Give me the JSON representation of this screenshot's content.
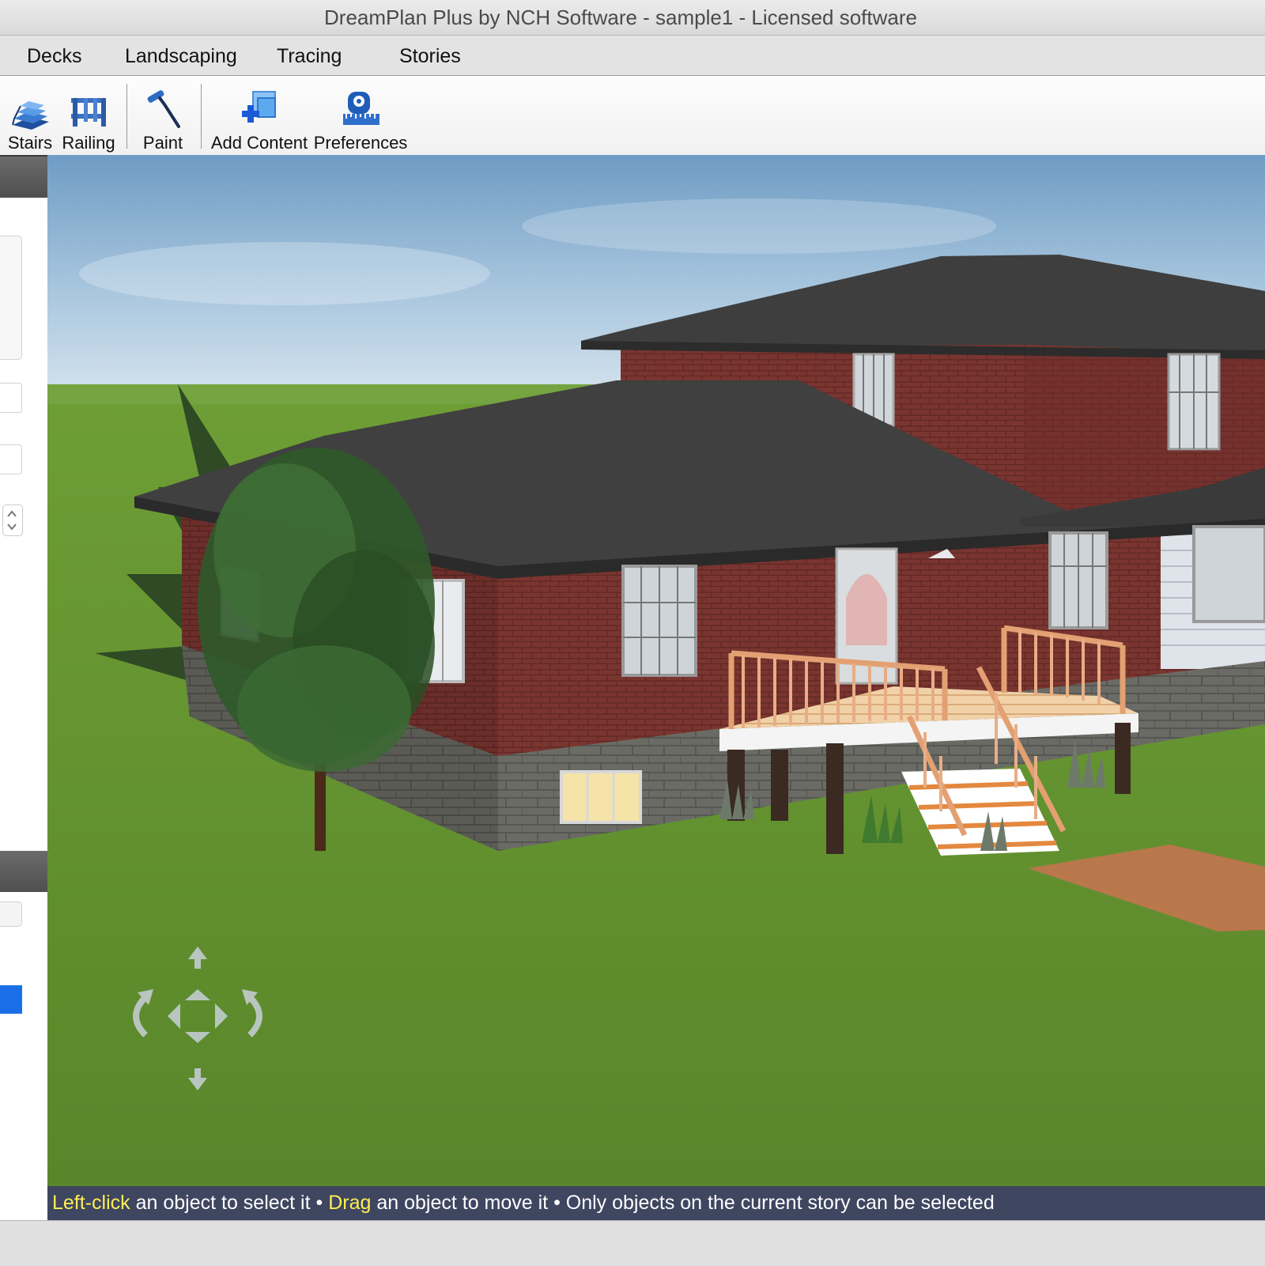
{
  "window": {
    "title": "DreamPlan Plus by NCH Software - sample1 - Licensed software"
  },
  "menu": {
    "items": [
      {
        "label": "Decks"
      },
      {
        "label": "Landscaping"
      },
      {
        "label": "Tracing"
      },
      {
        "label": "Stories"
      }
    ]
  },
  "toolbar": {
    "stairs": {
      "label": "Stairs",
      "icon": "stairs-icon"
    },
    "railing": {
      "label": "Railing",
      "icon": "railing-icon"
    },
    "paint": {
      "label": "Paint",
      "icon": "paint-roller-icon"
    },
    "add_content": {
      "label": "Add Content",
      "icon": "add-content-icon"
    },
    "preferences": {
      "label": "Preferences",
      "icon": "tape-measure-icon"
    }
  },
  "status": {
    "part1_highlight": "Left-click",
    "part1_text": " an object to select it • ",
    "part2_highlight": "Drag",
    "part2_text": " an object to move it • Only objects on the current story can be selected"
  },
  "colors": {
    "accent_blue": "#1a6fe8",
    "status_bg": "#3e4660",
    "status_highlight": "#ffee55",
    "sky": "#9fc0dc",
    "grass": "#5f8d2c"
  }
}
